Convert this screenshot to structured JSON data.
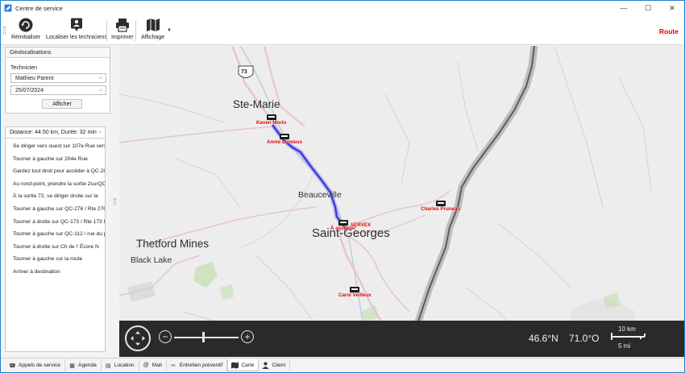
{
  "window": {
    "title": "Centre de service",
    "minimize": "—",
    "maximize": "☐",
    "close": "✕"
  },
  "toolbar": {
    "reset_label": "Réinitialiser",
    "locate_label": "Localiser les techniciens",
    "print_label": "Imprimer",
    "view_label": "Affichage",
    "mode_label": "Route"
  },
  "left": {
    "section_title": "Géolocalisations",
    "technician_label": "Technicien",
    "technician_value": "Mathieu Parent",
    "date_value": "25/07/2024",
    "show_button": "Afficher",
    "summary_value": "Distance: 44.50 km, Durée: 32 min",
    "directions": [
      "Se diriger vers ouest sur 107e Rue vers",
      "Tourner à gauche sur 204e Rue",
      "Gardez tout droit pour accéder à QC-20",
      "Au rond-point, prendre la sortie 2surQC",
      "À la sortie 72, se diriger   droite  sur la",
      "Tourner à gauche sur QC-276 / Rte 276",
      "Tourner à droite sur QC-173 / Rte 173 I",
      "Tourner à gauche sur QC-112 / rue du p",
      "Tourner à droite sur Ch de l' Écore N",
      "Tourner à gauche sur la route",
      "Arriver  à destination"
    ]
  },
  "map": {
    "highway_shield": "73",
    "places": {
      "ste_marie": "Ste-Marie",
      "beauceville": "Beauceville",
      "saint_georges": "Saint-Georges",
      "thetford": "Thetford Mines",
      "black_lake": "Black Lake"
    },
    "technicians": {
      "keven": "Keven Morin",
      "annie": "Annie Lemieux",
      "charles": "Charles Pruneau",
      "carol": "Carol Veilleux",
      "assign": "À assigner",
      "servex": "SERVEX"
    },
    "coords": {
      "lat": "46.6°N",
      "lon": "71.0°O"
    },
    "scale": {
      "km": "10 km",
      "mi": "5 mi"
    },
    "colors": {
      "route": "#3d3dd9",
      "route_halo": "#bcbcf2",
      "border": "#5c5c5c",
      "marker_text": "#d10000"
    }
  },
  "tabs": [
    {
      "label": "Appels de service",
      "icon": "phone-icon"
    },
    {
      "label": "Agenda",
      "icon": "calendar-icon"
    },
    {
      "label": "Location",
      "icon": "document-icon"
    },
    {
      "label": "Mail",
      "icon": "at-icon"
    },
    {
      "label": "Entretien préventif",
      "icon": "tools-icon"
    },
    {
      "label": "Carte",
      "icon": "map-icon"
    },
    {
      "label": "Client",
      "icon": "person-icon"
    }
  ]
}
